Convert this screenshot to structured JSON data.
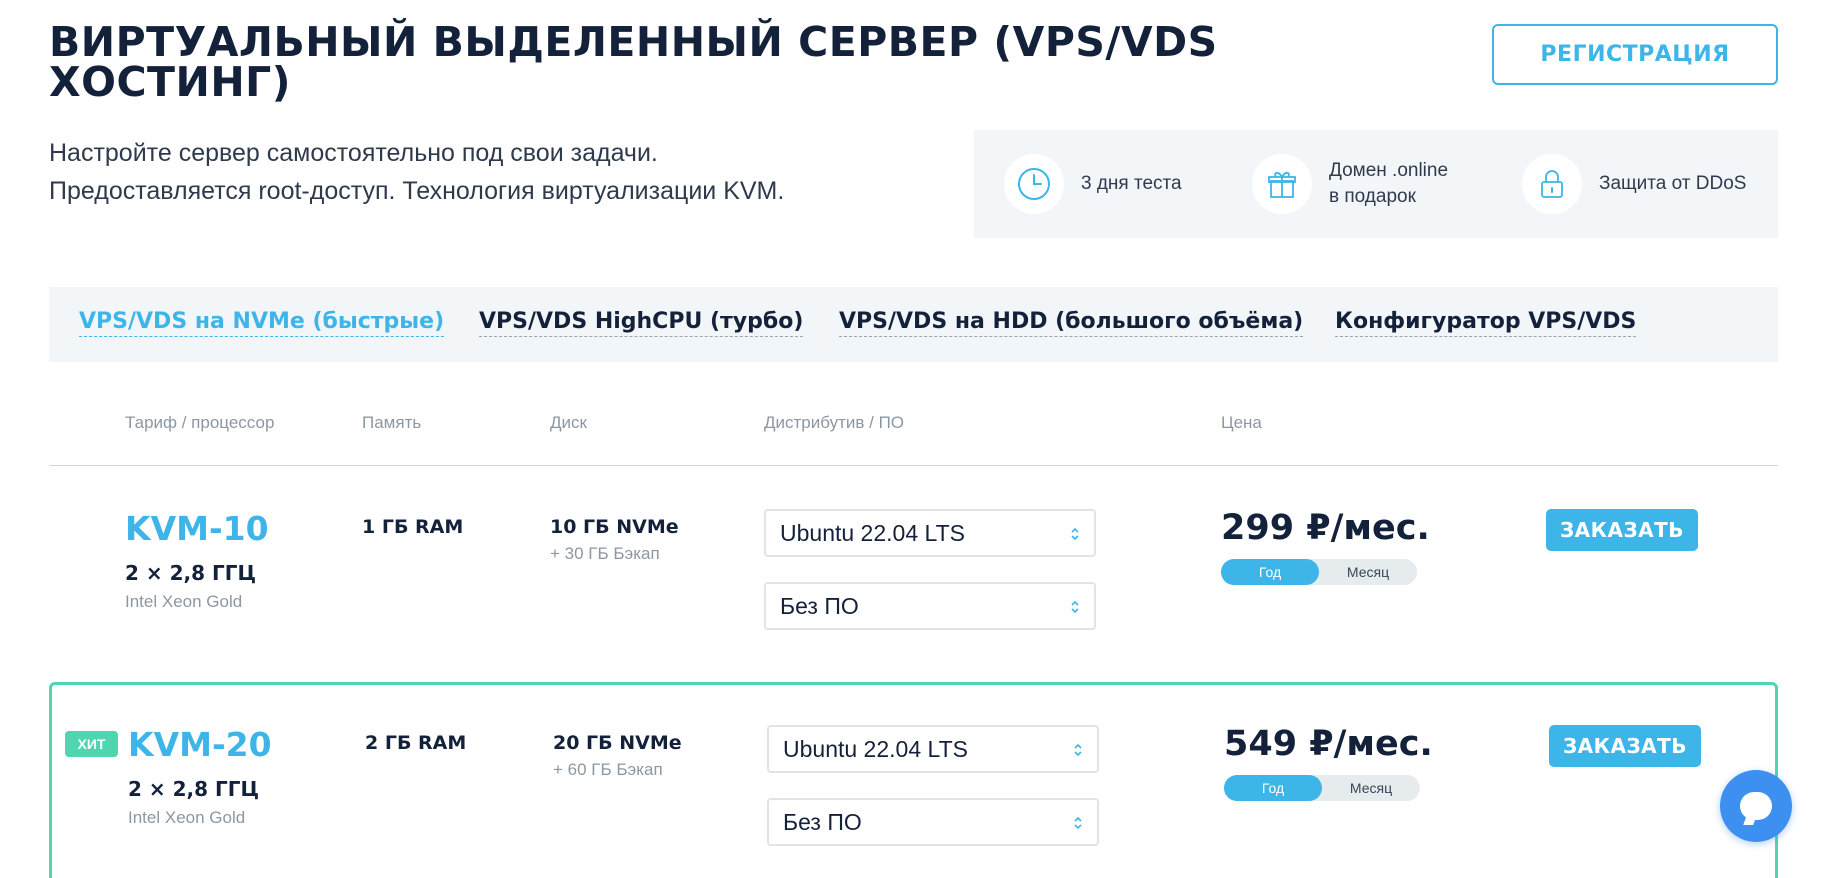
{
  "header": {
    "title": "ВИРТУАЛЬНЫЙ ВЫДЕЛЕННЫЙ СЕРВЕР (VPS/VDS ХОСТИНГ)",
    "register_label": "РЕГИСТРАЦИЯ",
    "subtitle_line1": "Настройте сервер самостоятельно под свои задачи.",
    "subtitle_line2": "Предоставляется root-доступ. Технология виртуализации KVM."
  },
  "features": [
    {
      "icon": "clock-icon",
      "text": "3 дня теста"
    },
    {
      "icon": "gift-icon",
      "line1": "Домен .online",
      "line2": "в подарок"
    },
    {
      "icon": "lock-icon",
      "text": "Защита от DDoS"
    }
  ],
  "tabs": [
    {
      "label": "VPS/VDS на NVMe (быстрые)",
      "active": true
    },
    {
      "label": "VPS/VDS HighCPU (турбо)"
    },
    {
      "label": "VPS/VDS на HDD (большого объёма)"
    },
    {
      "label": "Конфигуратор VPS/VDS"
    }
  ],
  "columns": {
    "tariff": "Тариф / процессор",
    "memory": "Память",
    "disk": "Диск",
    "distro": "Дистрибутив / ПО",
    "price": "Цена"
  },
  "plans": [
    {
      "name": "KVM-10",
      "cpu": "2 × 2,8 ГГЦ",
      "cpu_model": "Intel Xeon Gold",
      "ram": "1 ГБ RAM",
      "disk": "10 ГБ NVMe",
      "backup": "+ 30 ГБ Бэкап",
      "os": "Ubuntu 22.04 LTS",
      "software": "Без ПО",
      "price": "299 ₽/мес.",
      "period_year": "Год",
      "period_month": "Месяц",
      "order_label": "ЗАКАЗАТЬ"
    },
    {
      "badge": "ХИТ",
      "name": "KVM-20",
      "cpu": "2 × 2,8 ГГЦ",
      "cpu_model": "Intel Xeon Gold",
      "ram": "2 ГБ RAM",
      "disk": "20 ГБ NVMe",
      "backup": "+ 60 ГБ Бэкап",
      "os": "Ubuntu 22.04 LTS",
      "software": "Без ПО",
      "price": "549 ₽/мес.",
      "period_year": "Год",
      "period_month": "Месяц",
      "order_label": "ЗАКАЗАТЬ"
    }
  ],
  "colors": {
    "accent": "#3db5e8",
    "hit": "#4fd6b0",
    "dark": "#14213a",
    "muted": "#8c97a4",
    "chat": "#3d8ff0"
  }
}
